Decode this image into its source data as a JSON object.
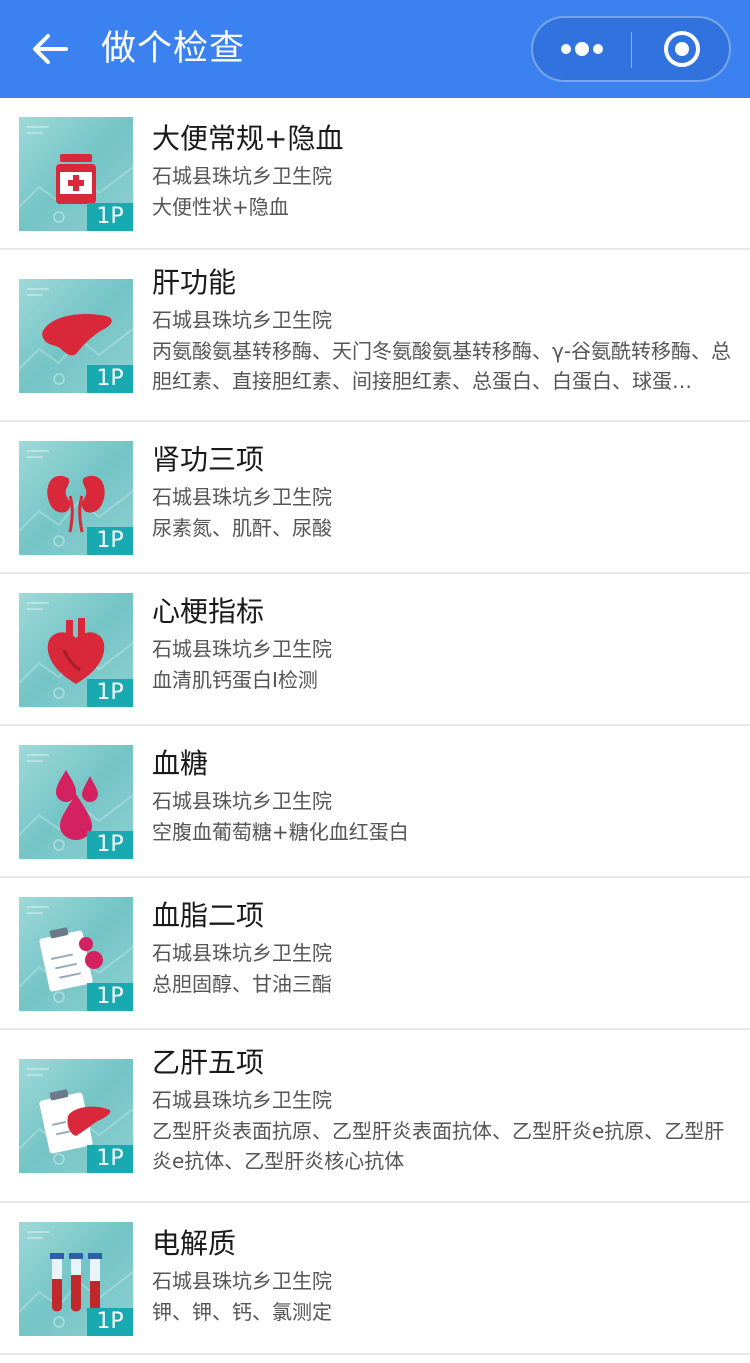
{
  "header": {
    "title": "做个检查",
    "colors": {
      "bar": "#3b82f0",
      "text": "#ffffff"
    },
    "icons": {
      "back": "arrow-left-icon",
      "more": "more-dots-icon",
      "close": "target-circle-icon"
    }
  },
  "thumb_badge": "1P",
  "items": [
    {
      "title": "大便常规+隐血",
      "hospital": "石城县珠坑乡卫生院",
      "desc": "大便性状+隐血",
      "icon": "medicine-bottle-icon"
    },
    {
      "title": "肝功能",
      "hospital": "石城县珠坑乡卫生院",
      "desc": "丙氨酸氨基转移酶、天门冬氨酸氨基转移酶、γ-谷氨酰转移酶、总胆红素、直接胆红素、间接胆红素、总蛋白、白蛋白、球蛋…",
      "icon": "liver-icon"
    },
    {
      "title": "肾功三项",
      "hospital": "石城县珠坑乡卫生院",
      "desc": "尿素氮、肌酐、尿酸",
      "icon": "kidneys-icon"
    },
    {
      "title": "心梗指标",
      "hospital": "石城县珠坑乡卫生院",
      "desc": "血清肌钙蛋白I检测",
      "icon": "heart-icon"
    },
    {
      "title": "血糖",
      "hospital": "石城县珠坑乡卫生院",
      "desc": "空腹血葡萄糖+糖化血红蛋白",
      "icon": "blood-drops-icon"
    },
    {
      "title": "血脂二项",
      "hospital": "石城县珠坑乡卫生院",
      "desc": "总胆固醇、甘油三酯",
      "icon": "clipboard-drops-icon"
    },
    {
      "title": "乙肝五项",
      "hospital": "石城县珠坑乡卫生院",
      "desc": "乙型肝炎表面抗原、乙型肝炎表面抗体、乙型肝炎e抗原、乙型肝炎e抗体、乙型肝炎核心抗体",
      "icon": "clipboard-liver-icon"
    },
    {
      "title": "电解质",
      "hospital": "石城县珠坑乡卫生院",
      "desc": "钾、钾、钙、氯测定",
      "icon": "test-tubes-icon"
    }
  ]
}
